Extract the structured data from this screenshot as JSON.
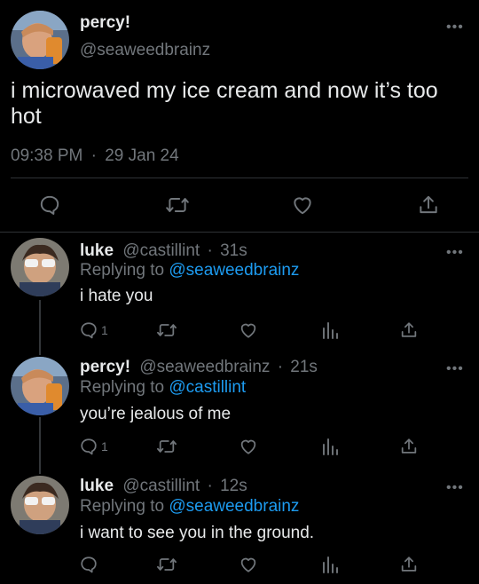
{
  "main_tweet": {
    "display_name": "percy!",
    "handle": "@seaweedbrainz",
    "text_line1": "i microwaved my ice cream and now it’s too",
    "text_line2": "hot",
    "time": "09:38 PM",
    "separator": "·",
    "date": "29 Jan 24"
  },
  "replies": [
    {
      "display_name": "luke",
      "handle": "@castillint",
      "separator": "·",
      "age": "31s",
      "replying_prefix": "Replying to",
      "replying_to": "@seaweedbrainz",
      "text": "i hate you",
      "reply_count": "1"
    },
    {
      "display_name": "percy!",
      "handle": "@seaweedbrainz",
      "separator": "·",
      "age": "21s",
      "replying_prefix": "Replying to",
      "replying_to": "@castillint",
      "text": "you’re jealous of me",
      "reply_count": "1"
    },
    {
      "display_name": "luke",
      "handle": "@castillint",
      "separator": "·",
      "age": "12s",
      "replying_prefix": "Replying to",
      "replying_to": "@seaweedbrainz",
      "text": "i want to see you in the ground.",
      "reply_count": ""
    }
  ],
  "more_glyph": "•••",
  "colors": {
    "background": "#000000",
    "text": "#e7e9ea",
    "muted": "#71767b",
    "link": "#1d9bf0",
    "divider": "#2f3336"
  }
}
